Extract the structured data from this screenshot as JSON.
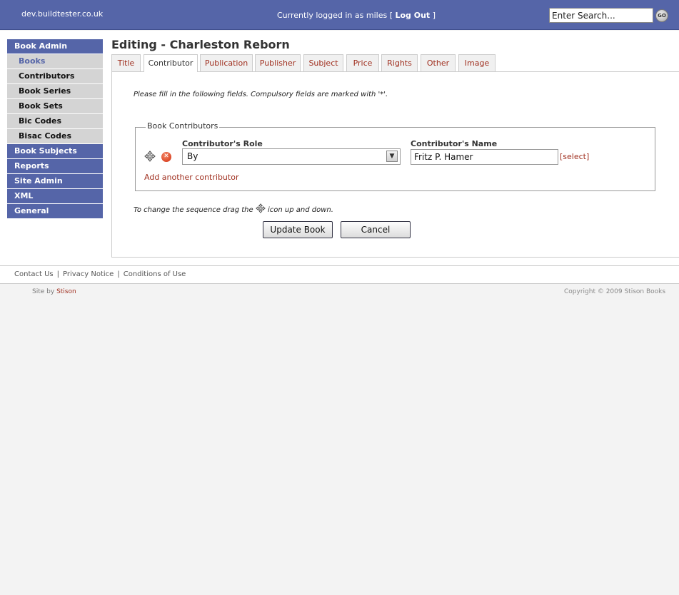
{
  "header": {
    "site_name": "dev.buildtester.co.uk",
    "login_prefix": "Currently logged in as miles [",
    "logout_label": "Log Out",
    "login_suffix": "]",
    "search_placeholder": "Enter Search...",
    "go_label": "GO"
  },
  "sidebar": {
    "items": [
      {
        "label": "Book Admin",
        "type": "main"
      },
      {
        "label": "Books",
        "type": "sub",
        "active": true
      },
      {
        "label": "Contributors",
        "type": "sub"
      },
      {
        "label": "Book Series",
        "type": "sub"
      },
      {
        "label": "Book Sets",
        "type": "sub"
      },
      {
        "label": "Bic Codes",
        "type": "sub"
      },
      {
        "label": "Bisac Codes",
        "type": "sub"
      },
      {
        "label": "Book Subjects",
        "type": "main"
      },
      {
        "label": "Reports",
        "type": "main"
      },
      {
        "label": "Site Admin",
        "type": "main"
      },
      {
        "label": "XML",
        "type": "main"
      },
      {
        "label": "General",
        "type": "main"
      }
    ]
  },
  "page": {
    "title": "Editing - Charleston Reborn",
    "active_tab": "Contributor",
    "tabs": [
      "Title",
      "Contributor",
      "Publication",
      "Publisher",
      "Subject",
      "Price",
      "Rights",
      "Other",
      "Image"
    ]
  },
  "form": {
    "intro": "Please fill in the following fields. Compulsory fields are marked with '*'.",
    "fieldset_legend": "Book Contributors",
    "role_label": "Contributor's Role",
    "role_value": "By",
    "name_label": "Contributor's Name",
    "name_value": "Fritz P. Hamer",
    "select_link": "[select]",
    "add_link": "Add another contributor",
    "drag_note_before": "To change the sequence drag the",
    "drag_note_after": "icon up and down.",
    "update_button": "Update Book",
    "cancel_button": "Cancel"
  },
  "footer": {
    "links": [
      "Contact Us",
      "Privacy Notice",
      "Conditions of Use"
    ],
    "credit_prefix": "Site by",
    "credit_name": "Stison",
    "copyright": "Copyright © 2009 Stison Books"
  },
  "colors": {
    "header_bg": "#5565a8",
    "link_red": "#a03020",
    "sub_menu_bg": "#d4d4d4"
  }
}
